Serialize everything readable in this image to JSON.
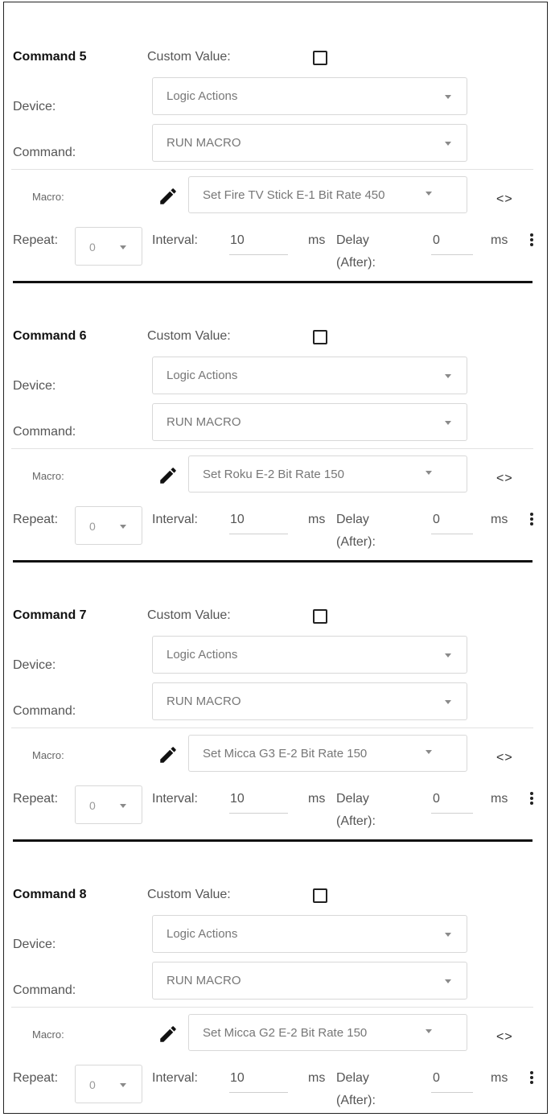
{
  "commands": [
    {
      "title": "Command 5",
      "custom_value_label": "Custom Value:",
      "device_label": "Device:",
      "device_value": "Logic Actions",
      "command_label": "Command:",
      "command_value": "RUN MACRO",
      "macro_label": "Macro:",
      "macro_value": "Set Fire TV Stick E-1 Bit Rate 450",
      "code_symbol": "<>",
      "repeat_label": "Repeat:",
      "repeat_value": "0",
      "interval_label": "Interval:",
      "interval_value": "10",
      "interval_unit": "ms",
      "delay_label": "Delay",
      "delay_label_2": "(After):",
      "delay_value": "0",
      "delay_unit": "ms"
    },
    {
      "title": "Command 6",
      "custom_value_label": "Custom Value:",
      "device_label": "Device:",
      "device_value": "Logic Actions",
      "command_label": "Command:",
      "command_value": "RUN MACRO",
      "macro_label": "Macro:",
      "macro_value": "Set Roku E-2 Bit Rate 150",
      "code_symbol": "<>",
      "repeat_label": "Repeat:",
      "repeat_value": "0",
      "interval_label": "Interval:",
      "interval_value": "10",
      "interval_unit": "ms",
      "delay_label": "Delay",
      "delay_label_2": "(After):",
      "delay_value": "0",
      "delay_unit": "ms"
    },
    {
      "title": "Command 7",
      "custom_value_label": "Custom Value:",
      "device_label": "Device:",
      "device_value": "Logic Actions",
      "command_label": "Command:",
      "command_value": "RUN MACRO",
      "macro_label": "Macro:",
      "macro_value": "Set Micca G3 E-2 Bit Rate 150",
      "code_symbol": "<>",
      "repeat_label": "Repeat:",
      "repeat_value": "0",
      "interval_label": "Interval:",
      "interval_value": "10",
      "interval_unit": "ms",
      "delay_label": "Delay",
      "delay_label_2": "(After):",
      "delay_value": "0",
      "delay_unit": "ms"
    },
    {
      "title": "Command 8",
      "custom_value_label": "Custom Value:",
      "device_label": "Device:",
      "device_value": "Logic Actions",
      "command_label": "Command:",
      "command_value": "RUN MACRO",
      "macro_label": "Macro:",
      "macro_value": "Set Micca G2 E-2 Bit Rate 150",
      "code_symbol": "<>",
      "repeat_label": "Repeat:",
      "repeat_value": "0",
      "interval_label": "Interval:",
      "interval_value": "10",
      "interval_unit": "ms",
      "delay_label": "Delay",
      "delay_label_2": "(After):",
      "delay_value": "0",
      "delay_unit": "ms"
    }
  ]
}
